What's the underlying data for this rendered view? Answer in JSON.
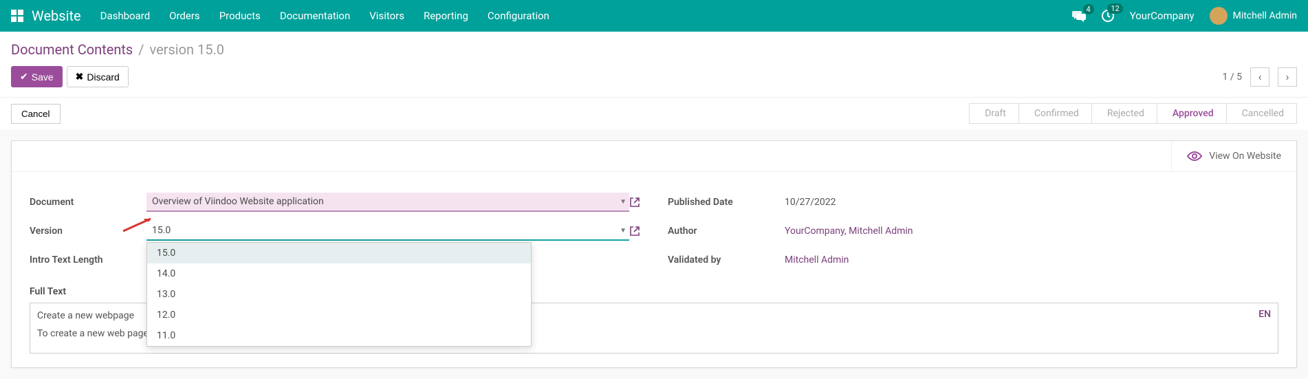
{
  "nav": {
    "brand": "Website",
    "items": [
      "Dashboard",
      "Orders",
      "Products",
      "Documentation",
      "Visitors",
      "Reporting",
      "Configuration"
    ],
    "chat_badge": "4",
    "activity_badge": "12",
    "company": "YourCompany",
    "user": "Mitchell Admin"
  },
  "breadcrumb": {
    "parent": "Document Contents",
    "current": "version 15.0"
  },
  "buttons": {
    "save": "Save",
    "discard": "Discard",
    "cancel": "Cancel",
    "view_website": "View On Website"
  },
  "pager": {
    "text": "1 / 5"
  },
  "stages": [
    "Draft",
    "Confirmed",
    "Rejected",
    "Approved",
    "Cancelled"
  ],
  "active_stage": "Approved",
  "form": {
    "labels": {
      "document": "Document",
      "version": "Version",
      "intro": "Intro Text Length",
      "published": "Published Date",
      "author": "Author",
      "validated": "Validated by",
      "full_text": "Full Text"
    },
    "values": {
      "document": "Overview of Viindoo Website application",
      "version": "15.0",
      "published": "10/27/2022",
      "author": "YourCompany, Mitchell Admin",
      "validated": "Mitchell Admin",
      "full_text_l1": "Create a new webpage",
      "full_text_l2": "To create a new web page",
      "lang": "EN"
    }
  },
  "dropdown": {
    "options": [
      "15.0",
      "14.0",
      "13.0",
      "12.0",
      "11.0"
    ]
  }
}
